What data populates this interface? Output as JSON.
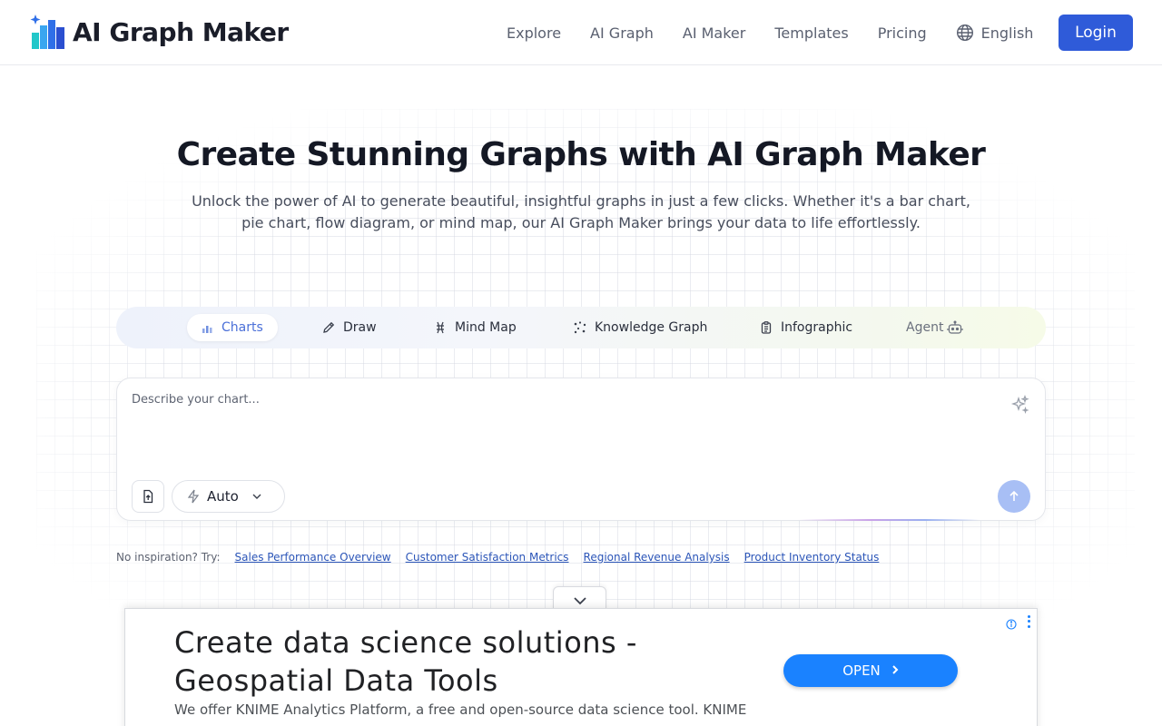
{
  "brand": {
    "name": "AI Graph Maker",
    "logo_icon": "bar-chart-sparkle-logo"
  },
  "nav": {
    "items": [
      "Explore",
      "AI Graph",
      "AI Maker",
      "Templates",
      "Pricing"
    ],
    "language": "English",
    "login": "Login"
  },
  "hero": {
    "title": "Create Stunning Graphs with AI Graph Maker",
    "subtitle": "Unlock the power of AI to generate beautiful, insightful graphs in just a few clicks. Whether it's a bar chart, pie chart, flow diagram, or mind map, our AI Graph Maker brings your data to life effortlessly."
  },
  "tabs": [
    {
      "label": "Charts",
      "icon": "bar-chart-icon",
      "active": true
    },
    {
      "label": "Draw",
      "icon": "pencil-icon",
      "active": false
    },
    {
      "label": "Mind Map",
      "icon": "mind-map-icon",
      "active": false
    },
    {
      "label": "Knowledge Graph",
      "icon": "knowledge-graph-icon",
      "active": false
    },
    {
      "label": "Infographic",
      "icon": "clipboard-icon",
      "active": false
    },
    {
      "label": "Agent",
      "icon": "robot-icon",
      "active": false
    }
  ],
  "prompt": {
    "placeholder": "Describe your chart...",
    "mode": "Auto"
  },
  "suggestions": {
    "label": "No inspiration? Try:",
    "items": [
      "Sales Performance Overview",
      "Customer Satisfaction Metrics",
      "Regional Revenue Analysis",
      "Product Inventory Status"
    ]
  },
  "ad": {
    "title": "Create data science solutions - Geospatial Data Tools",
    "description": "We offer KNIME Analytics Platform, a free and open-source data science tool. KNIME",
    "cta": "OPEN"
  },
  "colors": {
    "primary": "#2f5bd9",
    "accent": "#4a6fd8",
    "send_disabled": "#a8bff5",
    "ad_cta": "#1a82ff"
  }
}
